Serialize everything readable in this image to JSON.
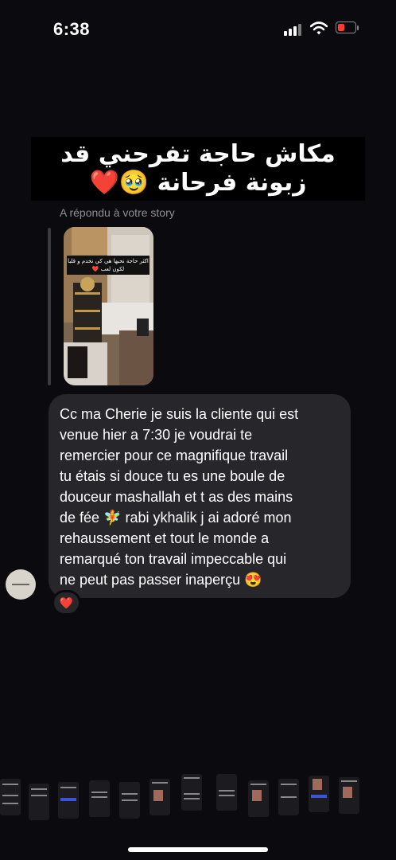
{
  "status_bar": {
    "time": "6:38"
  },
  "story": {
    "caption_line1": "مكاش حاجة تفرحني قد",
    "caption_line2": "زبونة فرحانة 🥹❤️",
    "thumb_caption": "اكثر حاجة نحبها هي كي نخدم و قلبا لكون لعب ❤️",
    "reply_label": "A répondu à votre story"
  },
  "message": {
    "text": "Cc ma Cherie je suis la cliente qui est\nvenue hier a 7:30 je voudrai te\nremercier pour ce magnifique travail\ntu étais si douce tu es une boule de\ndouceur mashallah et t as des mains\nde fée 🧚 rabi ykhalik j ai adoré mon\nrehaussement et tout le monde a\nremarqué ton travail impeccable qui\nne peut pas passer inaperçu 😍",
    "reaction": "❤️"
  },
  "colors": {
    "background": "#0b0b0f",
    "bubble": "#26262b",
    "muted_text": "#8e8e93",
    "battery_low": "#ff3b30"
  },
  "icons": [
    "signal-icon",
    "wifi-icon",
    "battery-icon"
  ]
}
